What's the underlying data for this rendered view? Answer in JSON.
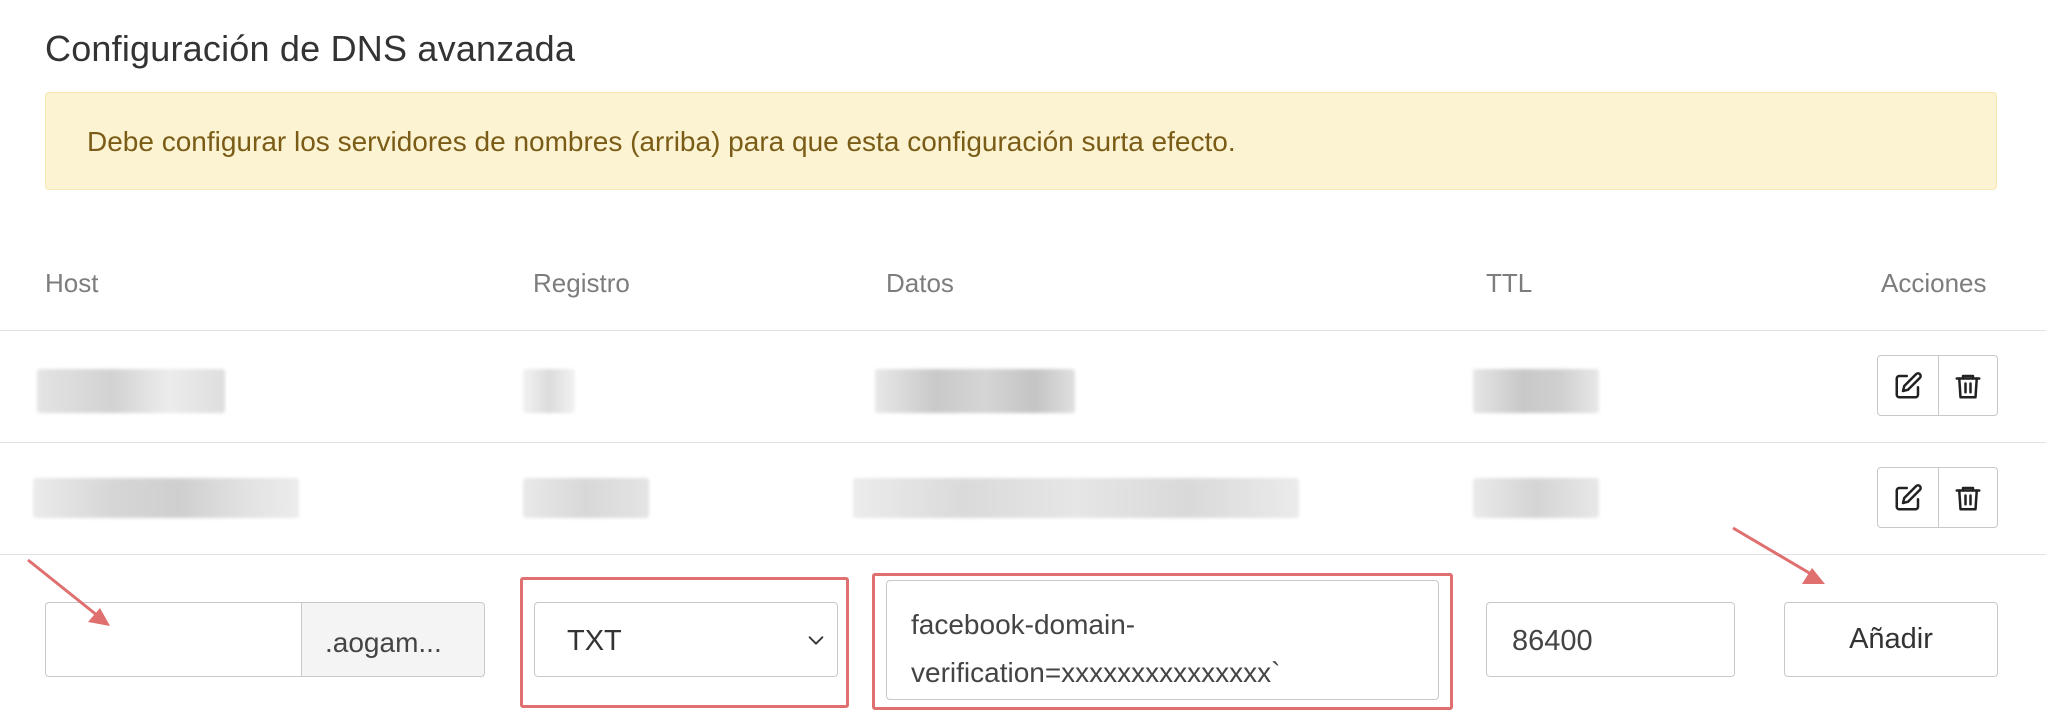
{
  "page_title": "Configuración de DNS avanzada",
  "alert": {
    "message": "Debe configurar los servidores de nombres (arriba) para que esta configuración surta efecto."
  },
  "table": {
    "columns": {
      "host": "Host",
      "record": "Registro",
      "data": "Datos",
      "ttl": "TTL",
      "actions": "Acciones"
    },
    "rows_note_redacted": true,
    "actions": {
      "edit_icon": "edit-icon",
      "delete_icon": "trash-icon"
    }
  },
  "new_record": {
    "host_value": "",
    "host_suffix": ".aogam...",
    "record_type": "TXT",
    "data_value": "facebook-domain-verification=xxxxxxxxxxxxxxx`",
    "ttl_value": "86400",
    "add_label": "Añadir"
  },
  "colors": {
    "alert_bg": "#fcf3d3",
    "alert_text": "#7a5c17",
    "highlight": "#e06f6f"
  }
}
